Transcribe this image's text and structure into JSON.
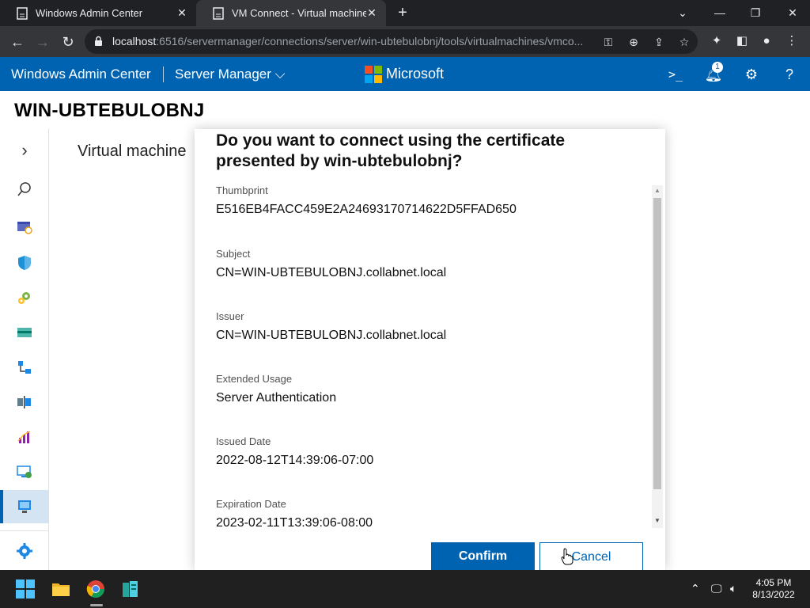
{
  "browser": {
    "tabs": [
      {
        "title": "Windows Admin Center",
        "active": false
      },
      {
        "title": "VM Connect - Virtual machines -",
        "active": true
      }
    ],
    "url_host": "localhost",
    "url_rest": ":6516/servermanager/connections/server/win-ubtebulobnj/tools/virtualmachines/vmco..."
  },
  "wac": {
    "brand": "Windows Admin Center",
    "section": "Server Manager",
    "vendor": "Microsoft",
    "notification_count": "1",
    "accent": "#0063b1"
  },
  "server": {
    "name": "WIN-UBTEBULOBNJ"
  },
  "page": {
    "title": "Virtual machine"
  },
  "dialog": {
    "title": "Do you want to connect using the certificate presented by win-ubtebulobnj?",
    "fields": [
      {
        "label": "Thumbprint",
        "value": "E516EB4FACC459E2A24693170714622D5FFAD650"
      },
      {
        "label": "Subject",
        "value": "CN=WIN-UBTEBULOBNJ.collabnet.local"
      },
      {
        "label": "Issuer",
        "value": "CN=WIN-UBTEBULOBNJ.collabnet.local"
      },
      {
        "label": "Extended Usage",
        "value": "Server Authentication"
      },
      {
        "label": "Issued Date",
        "value": "2022-08-12T14:39:06-07:00"
      },
      {
        "label": "Expiration Date",
        "value": "2023-02-11T13:39:06-08:00"
      }
    ],
    "confirm_label": "Confirm",
    "cancel_label": "Cancel"
  },
  "taskbar": {
    "time": "4:05 PM",
    "date": "8/13/2022"
  }
}
